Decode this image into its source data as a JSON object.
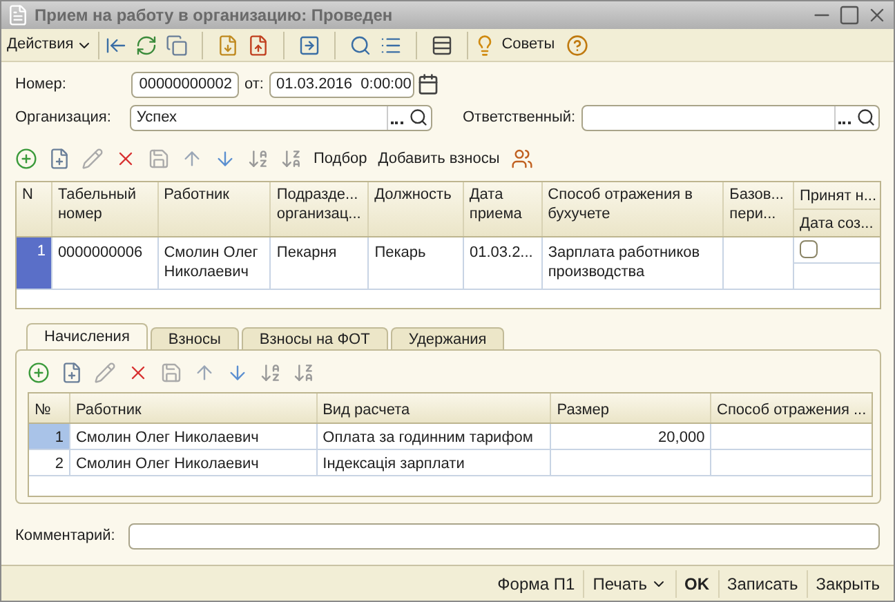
{
  "window": {
    "title": "Прием на работу в организацию: Проведен"
  },
  "toolbar": {
    "actions": "Действия",
    "tips": "Советы"
  },
  "header": {
    "number_label": "Номер:",
    "number": "00000000002",
    "date_label": "от:",
    "date": "01.03.2016  0:00:00",
    "org_label": "Организация:",
    "org": "Успех",
    "responsible_label": "Ответственный:"
  },
  "employees_toolbar": {
    "buttons": [
      "Подбор",
      "Добавить взносы"
    ]
  },
  "employees_table": {
    "columns": [
      {
        "label": "N"
      },
      {
        "label": "Табельный номер"
      },
      {
        "label": "Работник"
      },
      {
        "label": "Подразде... организац..."
      },
      {
        "label": "Должность"
      },
      {
        "label": "Дата приема"
      },
      {
        "label": "Способ отражения в бухучете"
      },
      {
        "label": "Базов... пери..."
      },
      {
        "label": "Принят н...",
        "sub_label": "Дата соз..."
      }
    ],
    "rows": [
      {
        "selected": true,
        "cells": [
          "1",
          "0000000006",
          "Смолин Олег Николаевич",
          "Пекарня",
          "Пекарь",
          "01.03.2...",
          "Зарплата работников производства",
          ""
        ],
        "checked": false
      }
    ]
  },
  "tabs": [
    {
      "label": "Начисления",
      "selected": true
    },
    {
      "label": "Взносы",
      "selected": false
    },
    {
      "label": "Взносы на ФОТ",
      "selected": false
    },
    {
      "label": "Удержания",
      "selected": false
    }
  ],
  "accruals_table": {
    "columns": [
      "№",
      "Работник",
      "Вид расчета",
      "Размер",
      "Способ отражения ..."
    ],
    "rows": [
      {
        "selected": true,
        "cells": [
          "1",
          "Смолин Олег Николаевич",
          "Оплата за годинним тарифом",
          "20,000",
          ""
        ]
      },
      {
        "selected": false,
        "cells": [
          "2",
          "Смолин Олег Николаевич",
          "Індексація зарплати",
          "",
          ""
        ]
      }
    ]
  },
  "comment": {
    "label": "Комментарий:"
  },
  "footer": [
    {
      "label": "Форма П1",
      "kind": "plain"
    },
    {
      "label": "Печать",
      "kind": "menu"
    },
    {
      "label": "OK",
      "kind": "default"
    },
    {
      "label": "Записать",
      "kind": "plain"
    },
    {
      "label": "Закрыть",
      "kind": "plain"
    }
  ]
}
